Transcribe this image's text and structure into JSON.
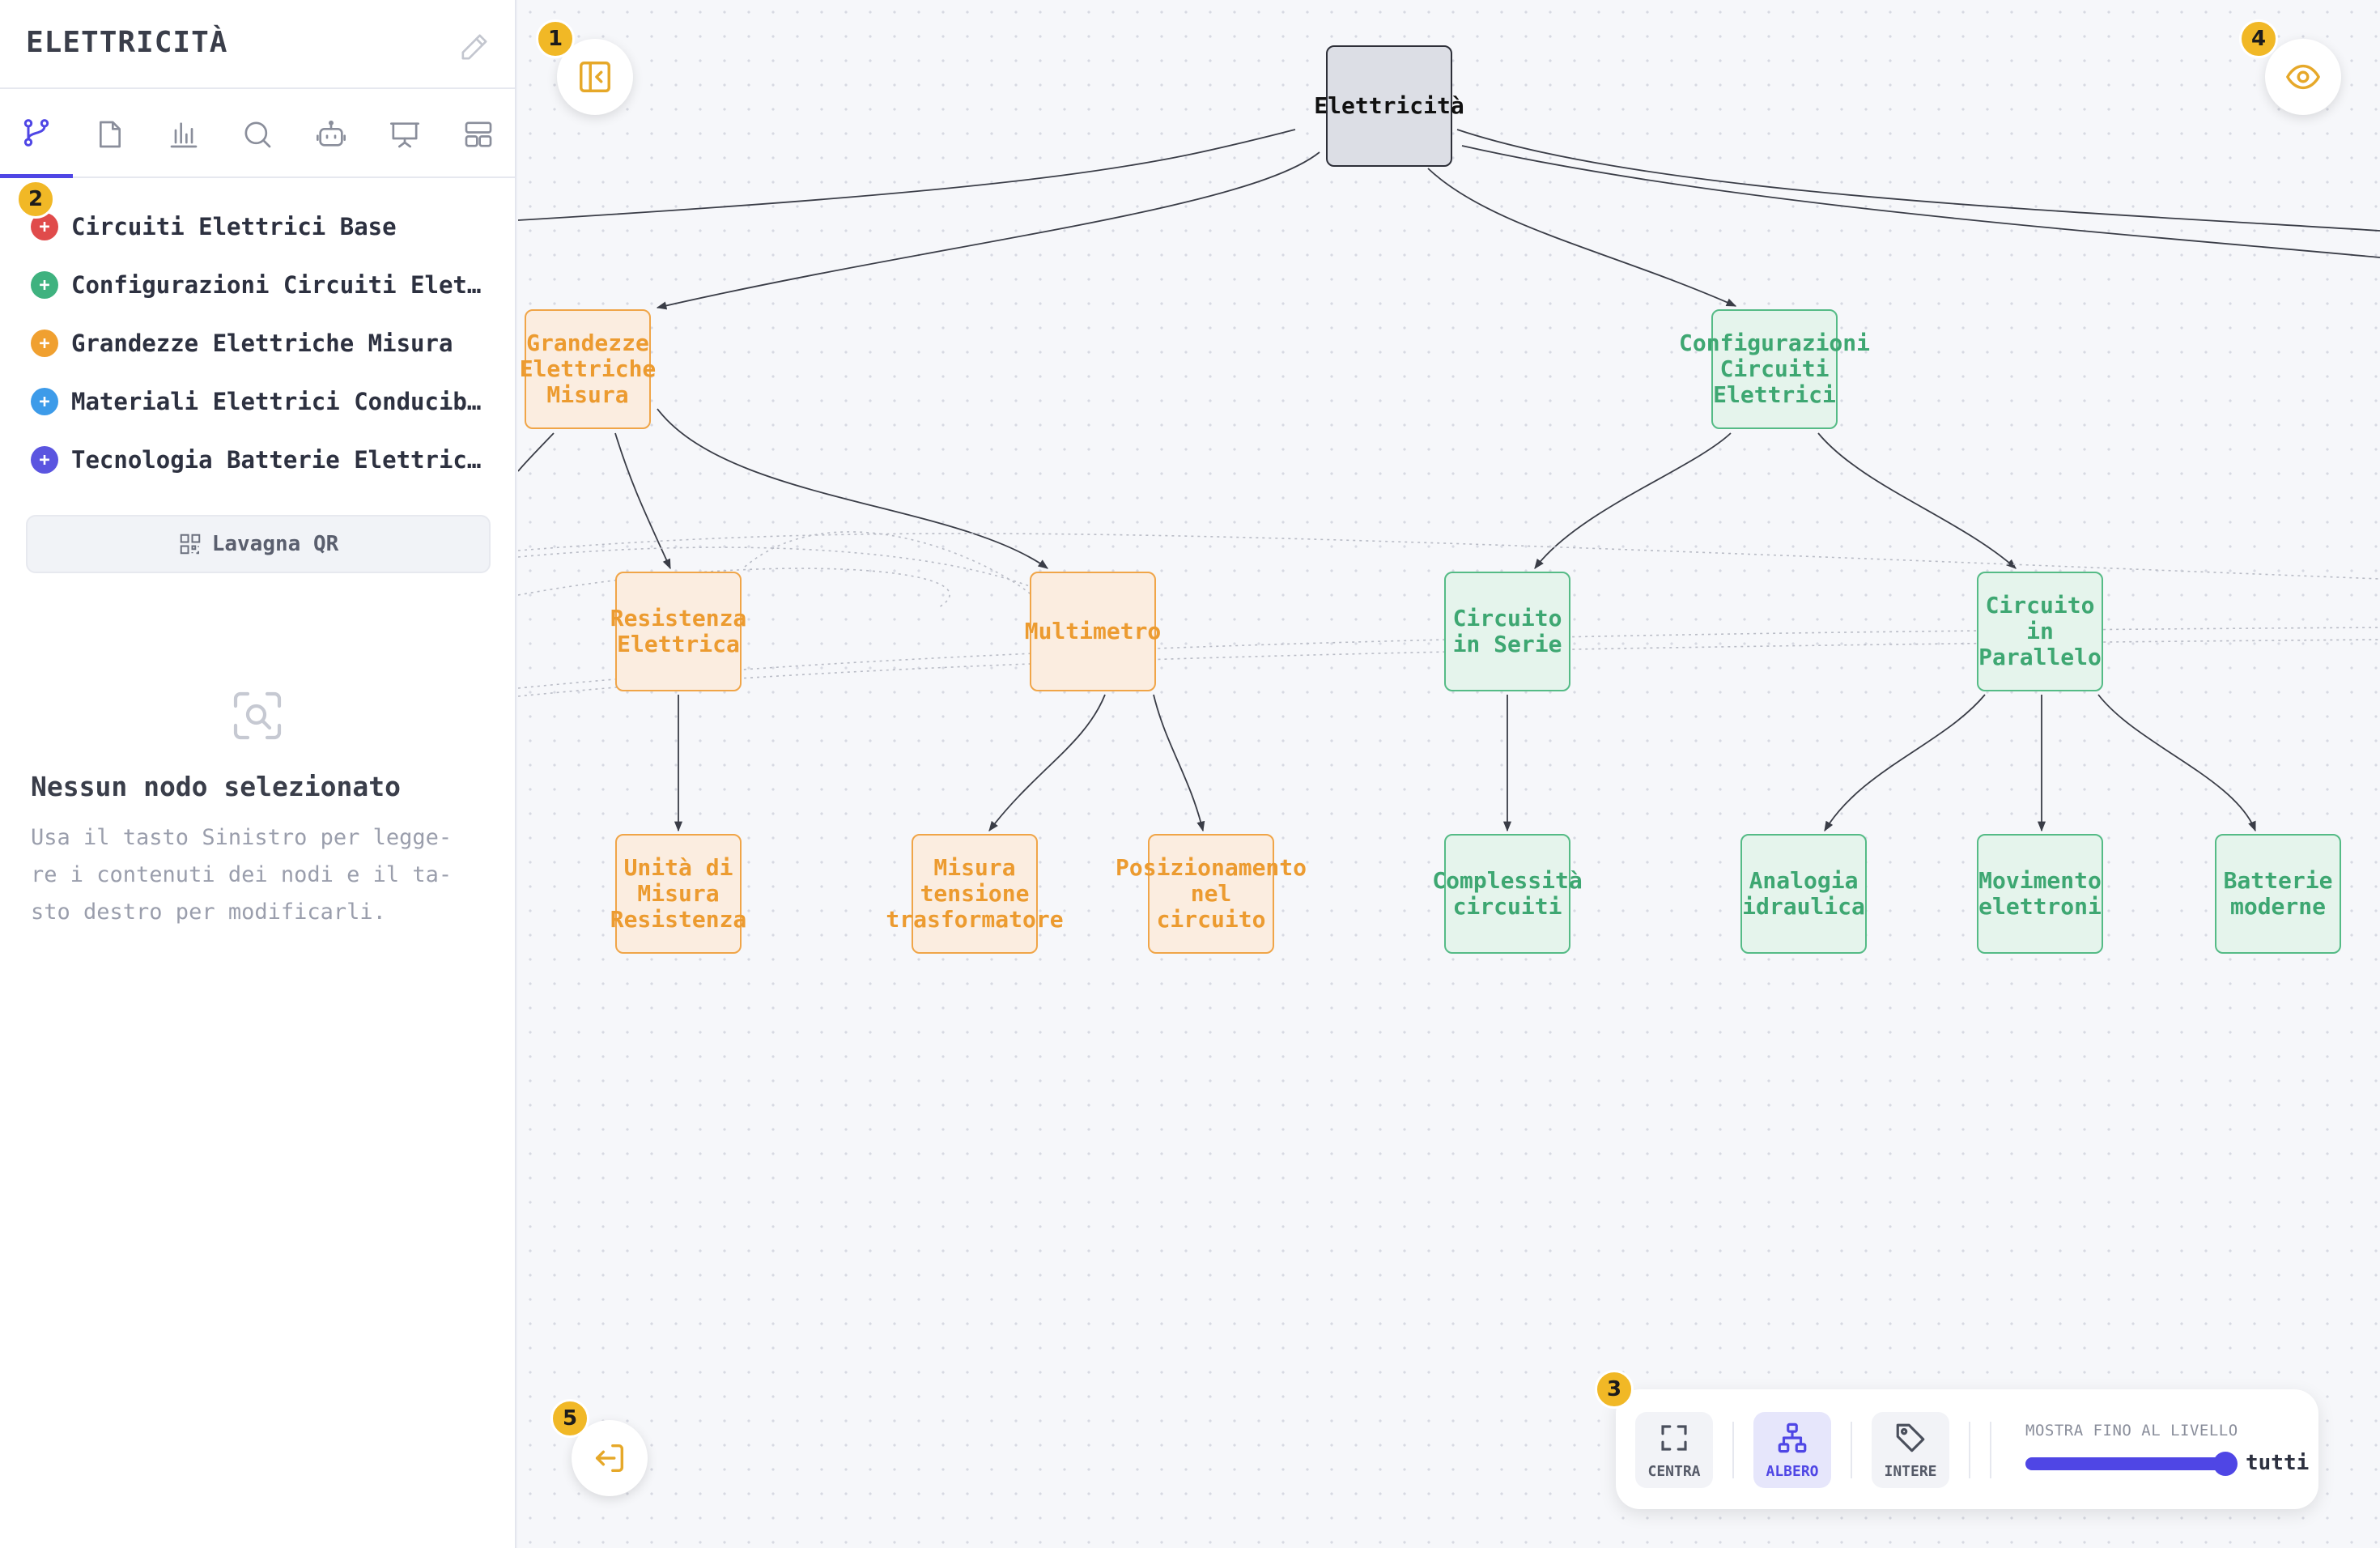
{
  "sidebar": {
    "title": "ELETTRICITÀ",
    "tabs": [
      {
        "icon": "branch-icon",
        "active": true
      },
      {
        "icon": "document-icon",
        "active": false
      },
      {
        "icon": "bar-chart-icon",
        "active": false
      },
      {
        "icon": "search-icon",
        "active": false
      },
      {
        "icon": "robot-icon",
        "active": false
      },
      {
        "icon": "presentation-icon",
        "active": false
      },
      {
        "icon": "layout-icon",
        "active": false
      }
    ],
    "branches": [
      {
        "label": "Circuiti Elettrici Base",
        "color": "#e04b4b"
      },
      {
        "label": "Configurazioni Circuiti Elettrici",
        "color": "#3fb27f"
      },
      {
        "label": "Grandezze Elettriche Misura",
        "color": "#f0a030"
      },
      {
        "label": "Materiali Elettrici Conducibilità",
        "color": "#3d9be9"
      },
      {
        "label": "Tecnologia Batterie Elettriche",
        "color": "#5b55e0"
      }
    ],
    "qr_button": "Lavagna QR",
    "empty_state": {
      "title": "Nessun nodo selezionato",
      "text": "Usa il tasto Sinistro per legge-\nre i contenuti dei nodi e il ta-\nsto destro per modificarli."
    }
  },
  "map": {
    "nodes": {
      "root": "Elettricità",
      "grandezze": "Grandezze\nElettriche\nMisura",
      "configurazioni": "Configurazioni\nCircuiti\nElettrici",
      "resistenza": "Resistenza\nElettrica",
      "multimetro": "Multimetro",
      "serie": "Circuito\nin Serie",
      "parallelo": "Circuito\nin\nParallelo",
      "unita": "Unità di\nMisura\nResistenza",
      "misura_tensione": "Misura\ntensione\ntrasformatore",
      "posizionamento": "Posizionamento\nnel\ncircuito",
      "complessita": "Complessità\ncircuiti",
      "analogia": "Analogia\nidraulica",
      "movimento": "Movimento\nelettroni",
      "batterie": "Batterie\nmoderne"
    },
    "colors": {
      "orange": "#f0a548",
      "green": "#55bb86",
      "root": "#2d2f38"
    }
  },
  "badges": [
    "1",
    "2",
    "3",
    "4",
    "5"
  ],
  "toolbar": {
    "center_label": "CENTRA",
    "tree_label": "ALBERO",
    "tags_label": "INTERE",
    "level_label": "MOSTRA FINO AL LIVELLO",
    "level_value": "tutti",
    "level_fraction": 1.0,
    "accent": "#4f46e5"
  }
}
